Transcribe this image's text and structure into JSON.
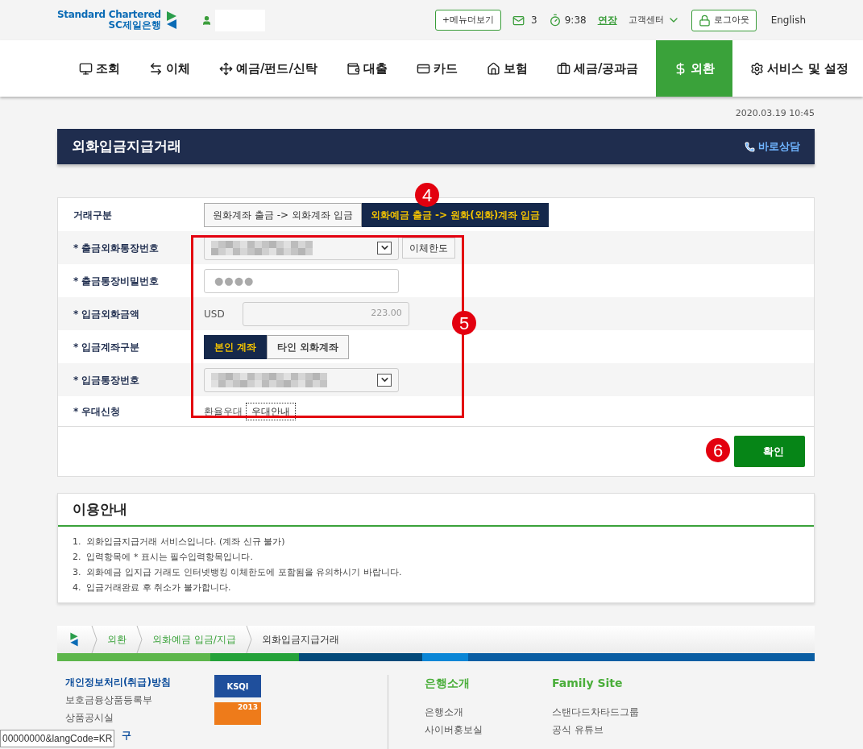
{
  "header": {
    "logo_line1": "Standard Chartered",
    "logo_line2": "SC제일은행",
    "menu_button": "+메뉴더보기",
    "mail_count": "3",
    "timer": "9:38",
    "extend_link": "연장",
    "support": "고객센터",
    "logout": "로그아웃",
    "language": "English"
  },
  "nav": [
    {
      "label": "조회",
      "kind": "inquiry",
      "selected": false
    },
    {
      "label": "이체",
      "kind": "transfer",
      "selected": false
    },
    {
      "label": "예금/펀드/신탁",
      "kind": "deposit",
      "selected": false
    },
    {
      "label": "대출",
      "kind": "loan",
      "selected": false
    },
    {
      "label": "카드",
      "kind": "card",
      "selected": false
    },
    {
      "label": "보험",
      "kind": "insurance",
      "selected": false
    },
    {
      "label": "세금/공과금",
      "kind": "tax",
      "selected": false
    },
    {
      "label": "외환",
      "kind": "fx",
      "selected": true
    },
    {
      "label": "서비스 및 설정",
      "kind": "settings",
      "selected": false
    }
  ],
  "datetime": "2020.03.19 10:45",
  "page_title": "외화입금지급거래",
  "consult_link": "바로상담",
  "form": {
    "type_label": "거래구분",
    "type_options": [
      {
        "label": "원화계좌 출금 -> 외화계좌 입금",
        "selected": false
      },
      {
        "label": "외화예금 출금 -> 원화(외화)계좌 입금",
        "selected": true
      }
    ],
    "rows": [
      {
        "kind": "select",
        "label": "* 출금외화통장번호",
        "button": "이체한도"
      },
      {
        "kind": "password",
        "label": "* 출금통장비밀번호",
        "value": "●●●●"
      },
      {
        "kind": "amount",
        "label": "* 입금외화금액",
        "currency": "USD",
        "value": "223.00"
      },
      {
        "kind": "toggle",
        "label": "* 입금계좌구분",
        "options": [
          {
            "label": "본인 계좌",
            "selected": true
          },
          {
            "label": "타인 외화계좌",
            "selected": false
          }
        ]
      },
      {
        "kind": "select",
        "label": "* 입금통장번호"
      },
      {
        "kind": "benefit",
        "label": "* 우대신청",
        "text": "환율우대",
        "button": "우대안내"
      }
    ],
    "confirm": "확인"
  },
  "annotations": [
    {
      "number": "4"
    },
    {
      "number": "5"
    },
    {
      "number": "6"
    }
  ],
  "guide": {
    "title": "이용안내",
    "items": [
      "1.  외화입금지급거래 서비스입니다. (계좌 신규 불가)",
      "2.  입력항목에 * 표시는 필수입력항목입니다.",
      "3.  외화예금 입지급 거래도 인터넷뱅킹 이체한도에 포함됨을 유의하시기 바랍니다.",
      "4.  입금거래완료 후 취소가 불가합니다."
    ]
  },
  "breadcrumb": [
    "외환",
    "외화예금 입금/지급",
    "외화입금지급거래"
  ],
  "footer": {
    "links": [
      "개인정보처리(취급)방침",
      "보호금융상품등록부",
      "상품공시실",
      "구"
    ],
    "badges": [
      "KSQI",
      "2013"
    ],
    "columns": [
      {
        "title": "은행소개",
        "items": [
          "은행소개",
          "사이버홍보실"
        ]
      },
      {
        "title": "Family Site",
        "items": [
          "스탠다드차타드그룹",
          "공식 유튜브"
        ]
      }
    ]
  },
  "status_url": "00000000&langCode=KR"
}
